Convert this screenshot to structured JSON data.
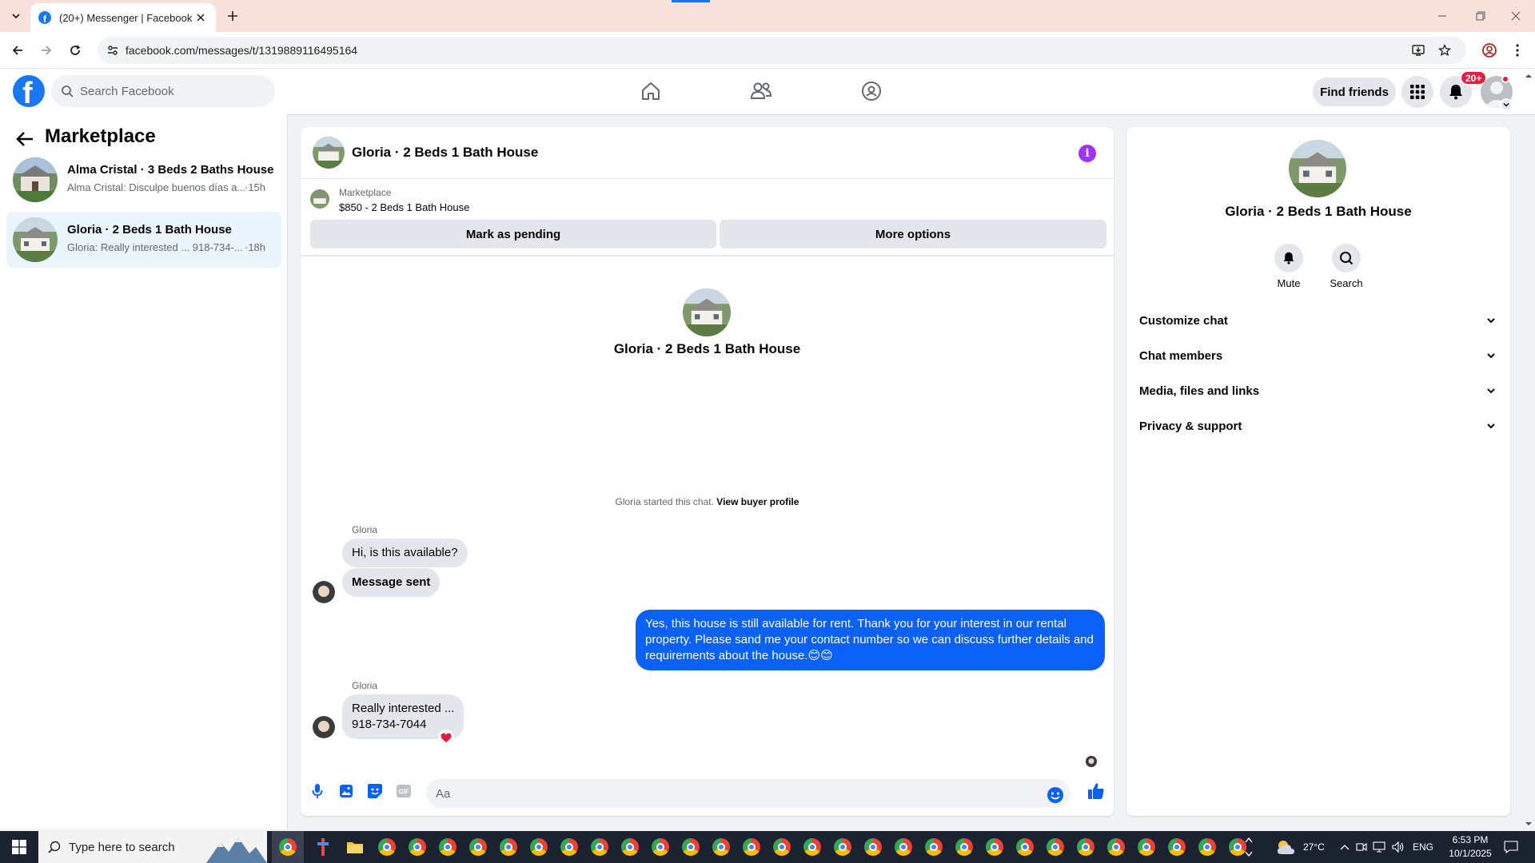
{
  "browser": {
    "tab_title": "(20+) Messenger | Facebook",
    "url": "facebook.com/messages/t/1319889116495164"
  },
  "fb": {
    "search_placeholder": "Search Facebook",
    "find_friends": "Find friends",
    "notif_count": "20+"
  },
  "sidebar": {
    "title": "Marketplace",
    "conversations": [
      {
        "name": "Alma Cristal · 3 Beds 2 Baths House",
        "preview": "Alma Cristal: Disculpe buenos días a...",
        "time": "·15h",
        "active": false
      },
      {
        "name": "Gloria · 2 Beds 1 Bath House",
        "preview": "Gloria: Really interested ... 918-734-...",
        "time": "·18h",
        "active": true
      }
    ]
  },
  "chat": {
    "title": "Gloria · 2 Beds 1 Bath House",
    "listing": {
      "label": "Marketplace",
      "price_title": "$850 - 2 Beds 1 Bath House",
      "mark_pending": "Mark as pending",
      "more_options": "More options"
    },
    "intro_title": "Gloria · 2 Beds 1 Bath House",
    "started_text": "Gloria started this chat.",
    "view_profile": "View buyer profile",
    "messages": [
      {
        "sender": "Gloria",
        "text": "Hi, is this available?"
      },
      {
        "text": "Message sent"
      },
      {
        "outgoing": true,
        "text": "Yes, this house is still available for rent. Thank you for your interest in our rental property. Please sand me your contact number so we can discuss further details and requirements about the house.😊😊"
      },
      {
        "sender": "Gloria",
        "text_line1": "Really interested ...",
        "text_line2": "918-734-7044",
        "reaction": "heart"
      }
    ],
    "composer_placeholder": "Aa"
  },
  "details": {
    "title": "Gloria · 2 Beds 1 Bath House",
    "mute": "Mute",
    "search": "Search",
    "sections": [
      "Customize chat",
      "Chat members",
      "Media, files and links",
      "Privacy & support"
    ]
  },
  "taskbar": {
    "search_placeholder": "Type here to search",
    "temperature": "27°C",
    "language": "ENG",
    "time": "6:53 PM",
    "date": "10/1/2025"
  },
  "colors": {
    "fb_blue": "#1877f2",
    "outgoing_bubble": "#0a61f7",
    "active_conversation": "#ebf5ff",
    "info_purple": "#a033ff",
    "tab_strip": "#f9e1db"
  }
}
